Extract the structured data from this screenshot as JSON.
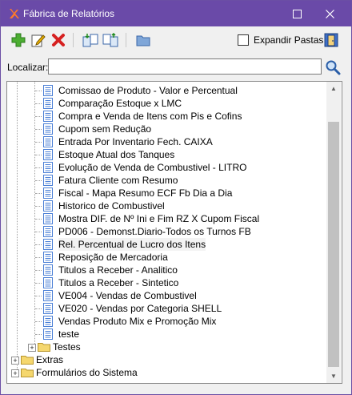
{
  "window": {
    "title": "Fábrica de Relatórios"
  },
  "titlebar": {
    "minimize": "▢",
    "close": "✕"
  },
  "toolbar": {
    "buttons": [
      {
        "icon": "add-icon"
      },
      {
        "icon": "edit-icon"
      },
      {
        "icon": "delete-icon"
      },
      {
        "icon": "import-icon"
      },
      {
        "icon": "export-icon"
      },
      {
        "icon": "folder-icon"
      }
    ],
    "expand_folders_label": "Expandir Pastas",
    "expand_folders_checked": false,
    "exit_icon": "exit-door-icon"
  },
  "search": {
    "label": "Localizar:",
    "value": "",
    "search_icon": "magnifier-icon"
  },
  "tree": {
    "reports": [
      "Comissao de Produto - Valor e Percentual",
      "Comparação Estoque x LMC",
      "Compra e Venda  de Itens com Pis e Cofins",
      "Cupom sem Redução",
      "Entrada Por Inventario Fech. CAIXA",
      "Estoque Atual dos Tanques",
      "Evolução de Venda de Combustivel - LITRO",
      "Fatura Cliente com Resumo",
      "Fiscal - Mapa Resumo ECF Fb Dia a Dia",
      "Historico de Combustivel",
      "Mostra DIF. de Nº Ini e Fim RZ X Cupom Fiscal",
      "PD006 - Demonst.Diario-Todos os Turnos FB",
      "Rel. Percentual de Lucro dos Itens",
      "Reposição de Mercadoria",
      "Titulos a Receber - Analitico",
      "Titulos a Receber - Sintetico",
      "VE004 - Vendas de Combustivel",
      "VE020 - Vendas por Categoria SHELL",
      "Vendas Produto Mix e Promoção Mix",
      "teste"
    ],
    "selected_index": 12,
    "subfolder": "Testes",
    "root_folders": [
      "Extras",
      "Formulários do Sistema"
    ],
    "expander_symbol": "+"
  },
  "colors": {
    "titlebar": "#6a4aa8",
    "folder": "#f5d76e",
    "doc": "#4a7fd6"
  }
}
